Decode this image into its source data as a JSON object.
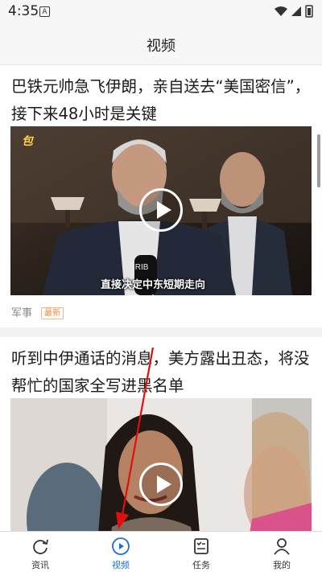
{
  "status": {
    "time": "4:35",
    "notification_glyph": "A"
  },
  "header": {
    "title": "视频"
  },
  "feed": [
    {
      "title": "巴铁元帅急飞伊朗，亲自送去“美国密信”，接下来48小时是关键",
      "caption": "直接决定中东短期走向",
      "logo": "包",
      "category": "军事",
      "badge": "最新"
    },
    {
      "title": "听到中伊通话的消息，美方露出丑态，将没帮忙的国家全写进黑名单"
    }
  ],
  "nav": [
    {
      "label": "资讯",
      "icon": "refresh-icon"
    },
    {
      "label": "视频",
      "icon": "play-circle-icon",
      "active": true
    },
    {
      "label": "任务",
      "icon": "task-list-icon"
    },
    {
      "label": "我的",
      "icon": "user-icon"
    }
  ],
  "colors": {
    "accent": "#1e6fd9",
    "annotation": "#e01010",
    "badge": "#f0883a"
  }
}
